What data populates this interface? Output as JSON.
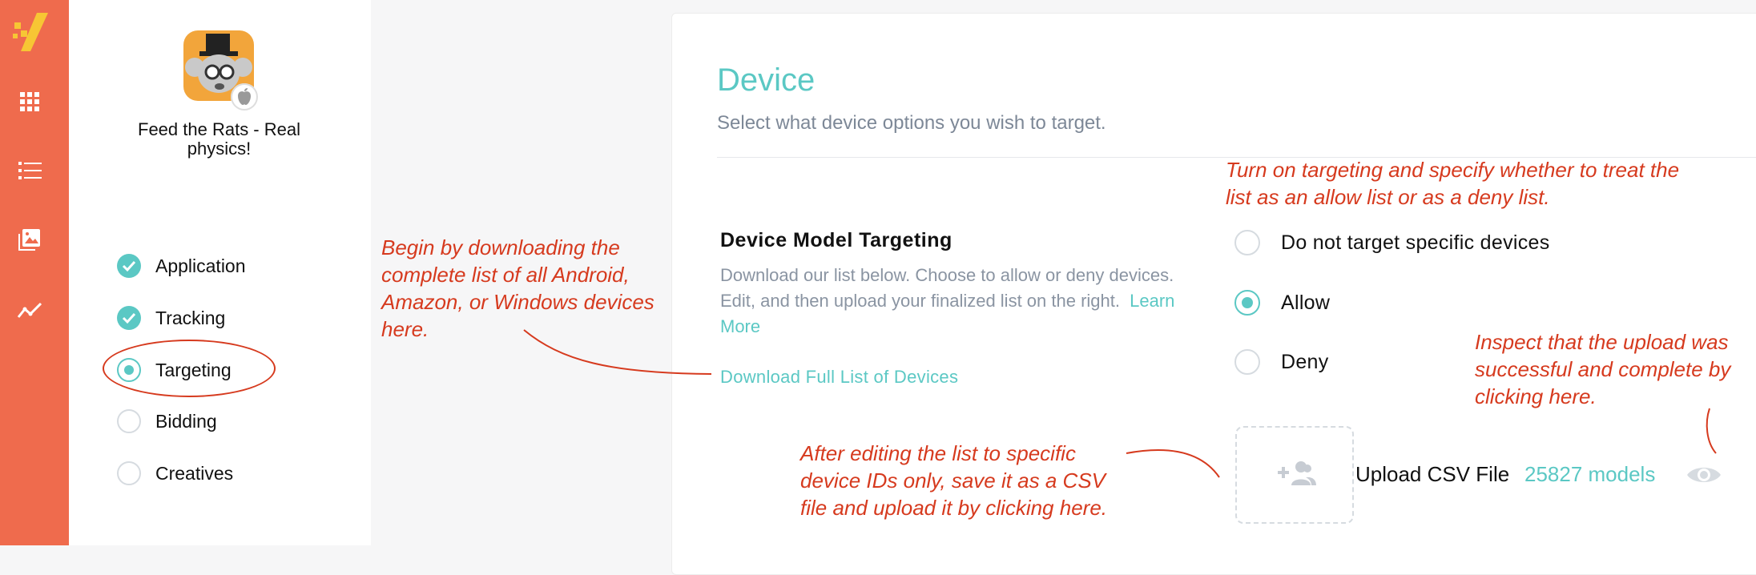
{
  "colors": {
    "accent": "#5bc8c4",
    "rail": "#ef6b4d",
    "annotation": "#d63a1e"
  },
  "sidebar": {
    "logo_icon": "brand-logo-icon",
    "nav_icons": [
      "grid-icon",
      "list-icon",
      "image-icon",
      "trend-icon"
    ]
  },
  "app": {
    "title": "Feed the Rats - Real physics!",
    "platform_icon": "apple-icon"
  },
  "steps": [
    {
      "label": "Application",
      "state": "done"
    },
    {
      "label": "Tracking",
      "state": "done"
    },
    {
      "label": "Targeting",
      "state": "current"
    },
    {
      "label": "Bidding",
      "state": "todo"
    },
    {
      "label": "Creatives",
      "state": "todo"
    }
  ],
  "main": {
    "title": "Device",
    "subtitle": "Select what device options you wish to target.",
    "device_model": {
      "title": "Device Model Targeting",
      "description": "Download our list below. Choose to allow or deny devices. Edit, and then upload your finalized list on the right.",
      "learn_more": "Learn More",
      "download_link": "Download Full List of Devices"
    },
    "options": [
      {
        "label": "Do not target specific devices",
        "selected": false
      },
      {
        "label": "Allow",
        "selected": true
      },
      {
        "label": "Deny",
        "selected": false
      }
    ],
    "upload": {
      "label": "Upload CSV File",
      "count": "25827 models",
      "icon": "add-users-icon",
      "view_icon": "eye-icon"
    }
  },
  "annotations": {
    "download": "Begin by downloading the complete list of all Android, Amazon, or Windows devices here.",
    "targeting": "Turn on targeting and specify whether to treat the list as an allow list or as a deny list.",
    "inspect": "Inspect that the upload was successful and complete by clicking here.",
    "upload": "After editing the list to specific device IDs only, save it as a CSV file and upload it by clicking here."
  }
}
